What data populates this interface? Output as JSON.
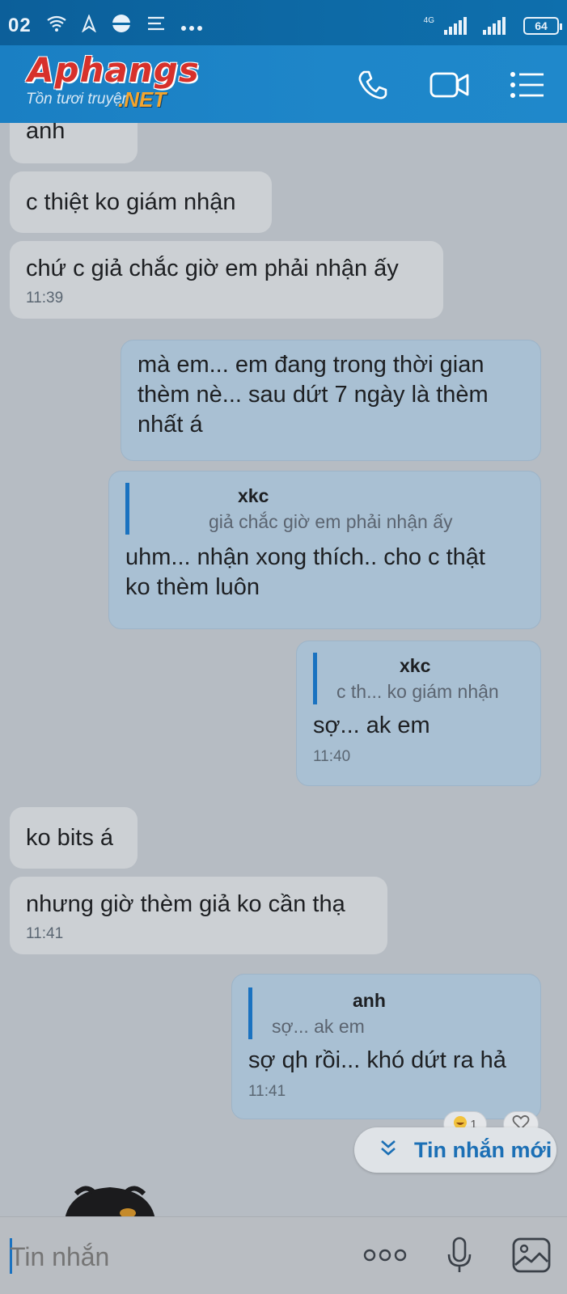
{
  "status_bar": {
    "time": "02",
    "network": "4G",
    "battery": "64"
  },
  "header": {
    "watermark_main": "Aphangs",
    "watermark_sub": "Tồn tươi truyện",
    "watermark_net": ".NET",
    "call_icon": "phone-icon",
    "video_icon": "video-camera-icon",
    "menu_icon": "list-menu-icon"
  },
  "messages": [
    {
      "dir": "in",
      "text": "anh",
      "time": ""
    },
    {
      "dir": "in",
      "text": "c thiệt ko giám nhận",
      "time": ""
    },
    {
      "dir": "in",
      "text": "chứ c giả chắc giờ em phải nhận ấy",
      "time": "11:39"
    },
    {
      "dir": "out",
      "text_lines": [
        "mà em... em đang trong thời gian",
        "thèm nè... sau dứt 7 ngày là thèm",
        "nhất á"
      ],
      "time": ""
    },
    {
      "dir": "out",
      "quote_name": "xkc",
      "quote_text": "giả chắc giờ em phải nhận ấy",
      "text_lines": [
        "uhm... nhận xong thích.. cho c thật",
        "ko thèm luôn"
      ],
      "time": ""
    },
    {
      "dir": "out",
      "quote_name": "xkc",
      "quote_text": "c th... ko giám nhận",
      "text": "sợ... ak em",
      "time": "11:40"
    },
    {
      "dir": "in",
      "text": "ko bits á",
      "time": ""
    },
    {
      "dir": "in",
      "text": "nhưng giờ thèm giả ko cần thạ",
      "time": "11:41"
    },
    {
      "dir": "out",
      "quote_name": "anh",
      "quote_text": "sợ... ak em",
      "text": "sợ qh rồi... khó dứt ra hả",
      "time": "11:41"
    }
  ],
  "reaction": {
    "count": "1"
  },
  "new_messages_button": {
    "label": "Tin nhắn mới"
  },
  "input_bar": {
    "placeholder": "Tin nhắn",
    "more_icon": "more-dots-icon",
    "mic_icon": "microphone-icon",
    "image_icon": "image-icon"
  },
  "colors": {
    "header": "#1e86c9",
    "accent": "#1a72c0",
    "incoming_bubble": "#ccd0d4",
    "outgoing_bubble": "#a9c0d3",
    "background": "#b6bcc3"
  }
}
